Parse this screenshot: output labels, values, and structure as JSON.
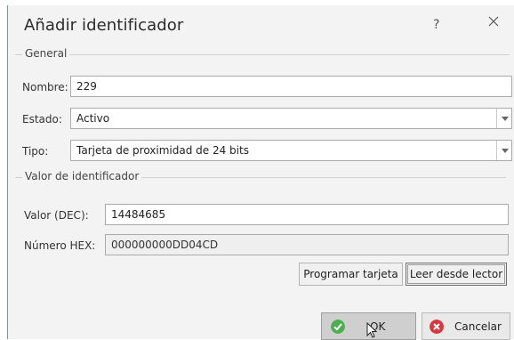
{
  "dialog": {
    "title": "Añadir identificador",
    "help_label": "?",
    "close_icon": "close-icon"
  },
  "general": {
    "legend": "General",
    "nombre_label": "Nombre:",
    "nombre_value": "229",
    "estado_label": "Estado:",
    "estado_value": "Activo",
    "tipo_label": "Tipo:",
    "tipo_value": "Tarjeta de proximidad de 24 bits"
  },
  "identificador": {
    "legend": "Valor de identificador",
    "valor_label": "Valor (DEC):",
    "valor_value": "14484685",
    "hex_label": "Número HEX:",
    "hex_value": "000000000DD04CD",
    "programar_label": "Programar tarjeta",
    "leer_label": "Leer desde lector"
  },
  "footer": {
    "ok_label": "OK",
    "cancel_label": "Cancelar"
  },
  "colors": {
    "ok_icon": "#4caf50",
    "cancel_icon": "#d9363e",
    "dialog_bg": "#f3f3f3"
  }
}
